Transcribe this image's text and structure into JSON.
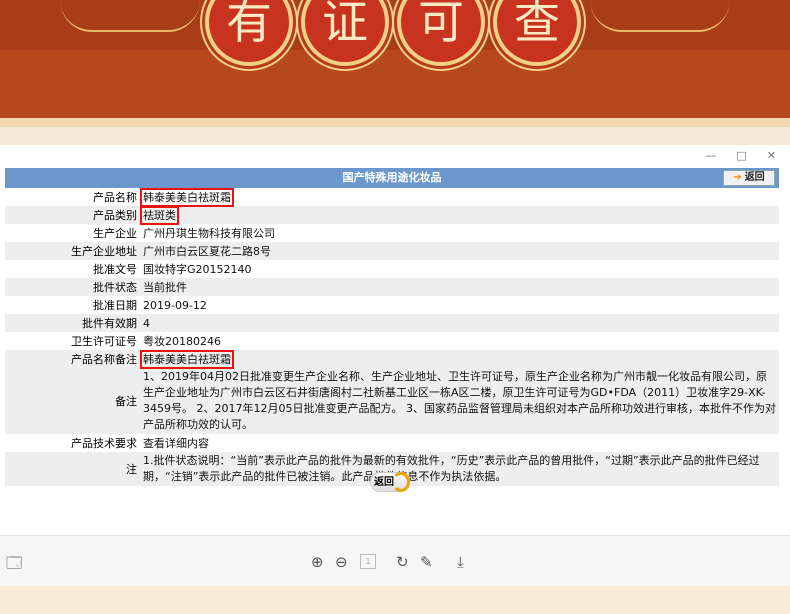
{
  "banner": {
    "chars": [
      "有",
      "证",
      "可",
      "查"
    ]
  },
  "window": {
    "controls": [
      "—",
      "□",
      "✕"
    ]
  },
  "page": {
    "title": "国产特殊用途化妆品",
    "back_label": "返回",
    "rows": [
      {
        "label": "产品名称",
        "value": "韩泰美美白祛斑霜"
      },
      {
        "label": "产品类别",
        "value": "祛斑类"
      },
      {
        "label": "生产企业",
        "value": "广州丹琪生物科技有限公司"
      },
      {
        "label": "生产企业地址",
        "value": "广州市白云区夏花二路8号"
      },
      {
        "label": "批准文号",
        "value": "国妆特字G20152140"
      },
      {
        "label": "批件状态",
        "value": "当前批件"
      },
      {
        "label": "批准日期",
        "value": "2019-09-12"
      },
      {
        "label": "批件有效期",
        "value": "4"
      },
      {
        "label": "卫生许可证号",
        "value": "粤妆20180246"
      },
      {
        "label": "产品名称备注",
        "value": "韩泰美美白祛斑霜"
      }
    ],
    "remark": {
      "label": "备注",
      "value": "1、2019年04月02日批准变更生产企业名称、生产企业地址、卫生许可证号，原生产企业名称为广州市靓一化妆品有限公司，原生产企业地址为广州市白云区石井街唐阁村二社新基工业区一栋A区二楼，原卫生许可证号为GD•FDA（2011）卫妆准字29-XK-3459号。 2、2017年12月05日批准变更产品配方。 3、国家药品监督管理局未组织对本产品所称功效进行审核，本批件不作为对产品所称功效的认可。"
    },
    "tech": {
      "label": "产品技术要求",
      "value": "查看详细内容"
    },
    "note": {
      "label": "注",
      "value": "1.批件状态说明：“当前”表示此产品的批件为最新的有效批件，“历史”表示此产品的曾用批件，“过期”表示此产品的批件已经过期，“注销”表示此产品的批件已被注销。此产品批件信息不作为执法依据。"
    },
    "bottom_back_label": "返回"
  },
  "toolbar": {
    "page_box": "1"
  }
}
